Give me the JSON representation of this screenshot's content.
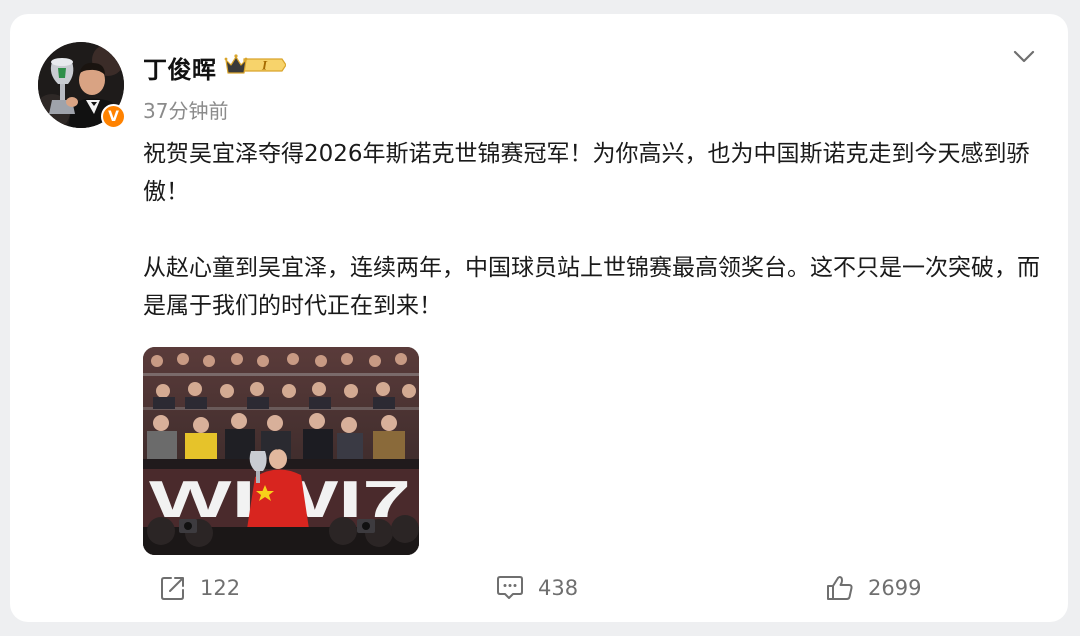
{
  "post": {
    "author": {
      "name": "丁俊晖",
      "verified_badge": "V",
      "member_badge_text": "I",
      "avatar_icon": "snooker-player-with-trophy-avatar"
    },
    "time": "37分钟前",
    "paragraphs": [
      "祝贺吴宜泽夺得2026年斯诺克世锦赛冠军！为你高兴，也为中国斯诺克走到今天感到骄傲！",
      "从赵心童到吴宜泽，连续两年，中国球员站上世锦赛最高领奖台。这不只是一次突破，而是属于我们的时代正在到来！"
    ],
    "image": {
      "banner_text": "WIWI7"
    },
    "actions": {
      "share_count": "122",
      "comment_count": "438",
      "like_count": "2699"
    }
  },
  "colors": {
    "page_bg": "#eeeff1",
    "verified_orange": "#ff8200",
    "gold": "#d9a52c",
    "flag_red": "#d8251f"
  }
}
